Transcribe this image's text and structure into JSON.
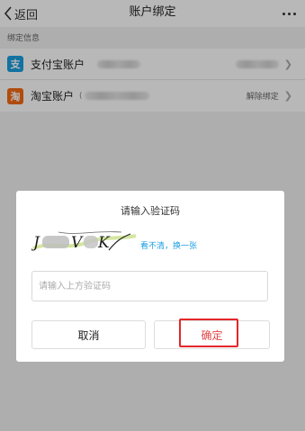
{
  "nav": {
    "back_label": "返回",
    "title": "账户绑定"
  },
  "section": {
    "header": "绑定信息"
  },
  "accounts": [
    {
      "icon": "alipay-icon",
      "icon_glyph": "支",
      "label": "支付宝账户",
      "account_prefix": "",
      "right_text": ""
    },
    {
      "icon": "taobao-icon",
      "icon_glyph": "淘",
      "label": "淘宝账户",
      "account_prefix": "(",
      "right_text": "解除绑定"
    }
  ],
  "dialog": {
    "title": "请输入验证码",
    "refresh_link": "看不清，换一张",
    "input_placeholder": "请输入上方验证码",
    "cancel_label": "取消",
    "confirm_label": "确定"
  },
  "colors": {
    "accent_blue": "#1a9ee0",
    "taobao_orange": "#f46a13",
    "confirm_red": "#e64545",
    "highlight_red": "#e4262a"
  }
}
